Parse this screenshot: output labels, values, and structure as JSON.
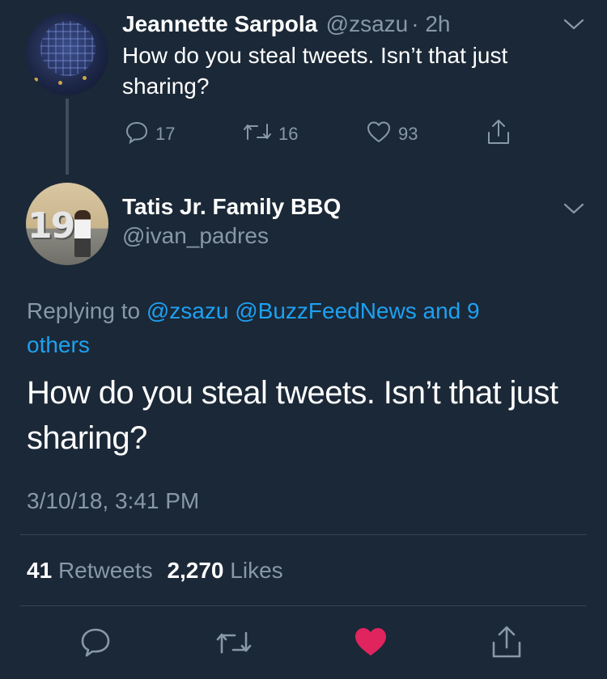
{
  "tweet1": {
    "name": "Jeannette Sarpola",
    "handle": "@zsazu",
    "time": "· 2h",
    "text": "How do you steal tweets. Isn’t that just sharing?",
    "actions": {
      "reply_count": "17",
      "retweet_count": "16",
      "like_count": "93"
    }
  },
  "tweet2": {
    "name": "Tatis Jr. Family BBQ",
    "handle": "@ivan_padres",
    "replying_prefix": "Replying to",
    "replying_to": "@zsazu @BuzzFeedNews and 9 others",
    "text": "How do you steal tweets. Isn’t that just sharing?",
    "timestamp": "3/10/18, 3:41 PM",
    "stats": {
      "retweets_count": "41",
      "retweets_label": "Retweets",
      "likes_count": "2,270",
      "likes_label": "Likes"
    }
  },
  "avatar2_number": "19",
  "colors": {
    "background": "#1b2837",
    "muted": "#8899a6",
    "link": "#1da1f2",
    "liked": "#e0245e"
  }
}
